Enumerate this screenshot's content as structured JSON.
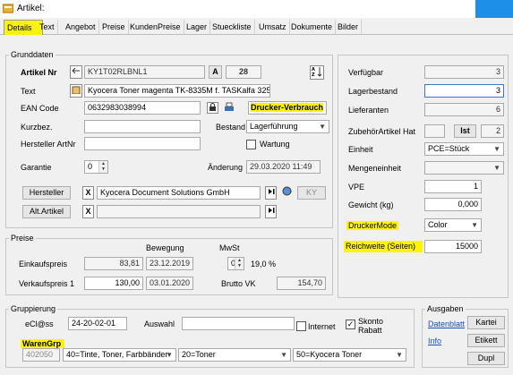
{
  "window": {
    "title": "Artikel:"
  },
  "tabs": [
    "Details",
    "Text",
    "Angebot",
    "Preise",
    "KundenPreise",
    "Lager",
    "Stueckliste",
    "Umsatz",
    "Dokumente",
    "Bilder"
  ],
  "grunddaten": {
    "legend": "Grunddaten",
    "artikel_nr_label": "Artikel Nr",
    "artikel_nr": "KY1T02RLBNL1",
    "a_label": "A",
    "a_value": "28",
    "text_label": "Text",
    "text_value": "Kyocera Toner magenta TK-8335M f. TASKalfa 3253ci",
    "ean_label": "EAN Code",
    "ean_value": "0632983038994",
    "drucker_value": "Drucker-Verbrauch",
    "kurzbez_label": "Kurzbez.",
    "kurzbez_value": "",
    "bestand_label": "Bestand",
    "bestand_value": "Lagerführung",
    "hersteller_artnr_label": "Hersteller ArtNr",
    "hersteller_artnr_value": "",
    "wartung_label": "Wartung",
    "garantie_label": "Garantie",
    "garantie_value": "0",
    "aenderung_label": "Änderung",
    "aenderung_value": "29.03.2020 11:49",
    "hersteller_btn": "Hersteller",
    "hersteller_value": "Kyocera Document Solutions GmbH",
    "ky_btn": "KY",
    "alt_artikel_btn": "Alt.Artikel",
    "alt_artikel_value": "",
    "x_label": "X"
  },
  "preise": {
    "legend": "Preise",
    "bewegung_label": "Bewegung",
    "mwst_label": "MwSt",
    "einkaufspreis_label": "Einkaufspreis",
    "einkaufspreis_value": "83,81",
    "einkauf_datum": "23.12.2019",
    "mwst_value": "0",
    "mwst_pct": "19,0 %",
    "verkaufspreis_label": "Verkaufspreis 1",
    "verkaufspreis_value": "130,00",
    "verkauf_datum": "03.01.2020",
    "brutto_label": "Brutto VK",
    "brutto_value": "154,70"
  },
  "right": {
    "verfuegbar_label": "Verfügbar",
    "verfuegbar_value": "3",
    "lagerbestand_label": "Lagerbestand",
    "lagerbestand_value": "3",
    "lieferanten_label": "Lieferanten",
    "lieferanten_value": "6",
    "zubehoer_label": "ZubehörArtikel",
    "hat_label": "Hat",
    "hat_value": "",
    "ist_label": "Ist",
    "ist_value": "2",
    "einheit_label": "Einheit",
    "einheit_value": "PCE=Stück",
    "mengeneinheit_label": "Mengeneinheit",
    "mengeneinheit_value": "",
    "vpe_label": "VPE",
    "vpe_value": "1",
    "gewicht_label": "Gewicht (kg)",
    "gewicht_value": "0,000",
    "druckermode_label": "DruckerMode",
    "druckermode_value": "Color",
    "reichweite_label": "Reichweite (Seiten)",
    "reichweite_value": "15000"
  },
  "gruppierung": {
    "legend": "Gruppierung",
    "ecl_label": "eCl@ss",
    "ecl_value": "24-20-02-01",
    "auswahl_label": "Auswahl",
    "auswahl_value": "",
    "internet_label": "Internet",
    "skonto_label": "Skonto Rabatt",
    "warengrp_label": "WarenGrp",
    "warengrp_code": "402050",
    "combo1": "40=Tinte, Toner, Farbbänder",
    "combo2": "20=Toner",
    "combo3": "50=Kyocera Toner"
  },
  "ausgaben": {
    "legend": "Ausgaben",
    "datenblatt": "Datenblatt",
    "info": "Info",
    "kartei": "Kartei",
    "etikett": "Etikett",
    "dupl": "Dupl"
  },
  "colors": {
    "highlight": "#fff500",
    "title_button": "#1e8fe8",
    "link": "#1a4fb5"
  }
}
